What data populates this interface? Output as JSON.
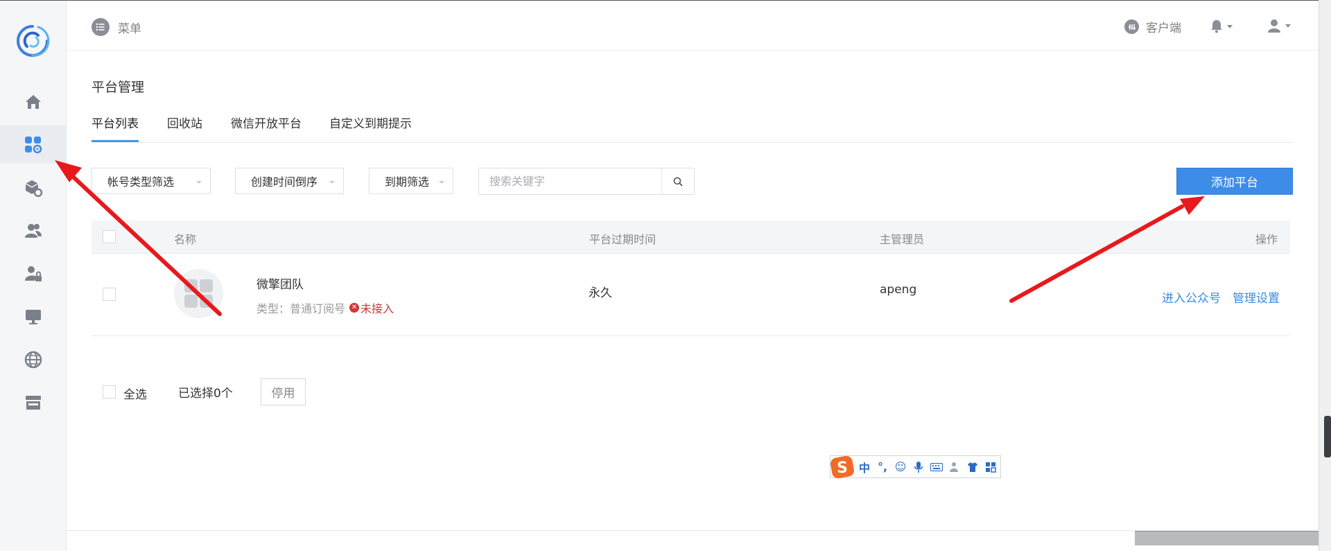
{
  "header": {
    "menu_label": "菜单",
    "client_label": "客户端"
  },
  "sidebar": {
    "items": [
      {
        "icon": "home-icon"
      },
      {
        "icon": "apps-settings-icon",
        "active": true
      },
      {
        "icon": "box-settings-icon"
      },
      {
        "icon": "users-icon"
      },
      {
        "icon": "user-lock-icon"
      },
      {
        "icon": "monitor-icon"
      },
      {
        "icon": "globe-icon"
      },
      {
        "icon": "store-icon"
      }
    ]
  },
  "page": {
    "title": "平台管理",
    "tabs": [
      {
        "label": "平台列表",
        "active": true
      },
      {
        "label": "回收站"
      },
      {
        "label": "微信开放平台"
      },
      {
        "label": "自定义到期提示"
      }
    ]
  },
  "filters": {
    "account_type": "帐号类型筛选",
    "create_time": "创建时间倒序",
    "expire": "到期筛选",
    "search_placeholder": "搜索关键字",
    "add_button": "添加平台"
  },
  "table": {
    "headers": {
      "name": "名称",
      "expire_time": "平台过期时间",
      "admin": "主管理员",
      "actions": "操作"
    },
    "rows": [
      {
        "name": "微擎团队",
        "type_label": "类型：",
        "type_value": "普通订阅号",
        "status": "未接入",
        "expire": "永久",
        "admin": "apeng",
        "action_enter": "进入公众号",
        "action_manage": "管理设置"
      }
    ]
  },
  "footer": {
    "select_all": "全选",
    "selected_count": "已选择0个",
    "disable_button": "停用"
  },
  "ime": {
    "items": [
      "中",
      "°,",
      "☺",
      "mic",
      "keyboard",
      "person",
      "shirt",
      "grid"
    ]
  },
  "colors": {
    "accent": "#3d8ce8",
    "link": "#3a8be0",
    "danger": "#d0363b",
    "annotation_arrow": "#e8191c"
  }
}
